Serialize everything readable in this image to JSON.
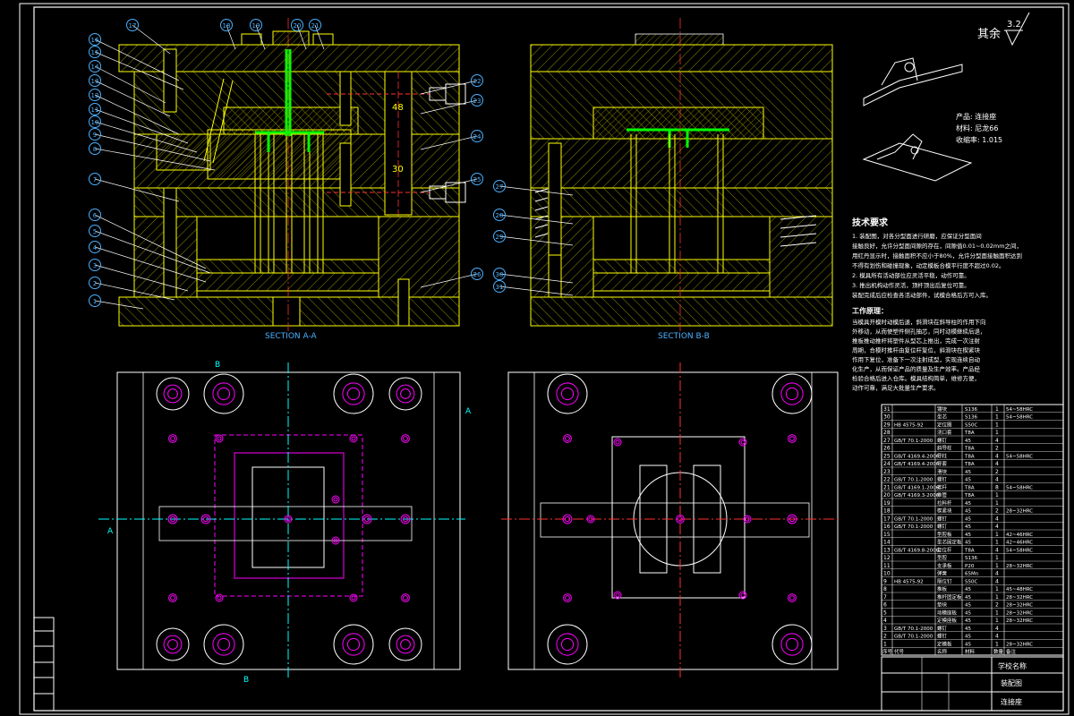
{
  "surface_finish": {
    "label": "其余",
    "value": "3.2"
  },
  "sections": {
    "a": "SECTION A-A",
    "b": "SECTION B-B"
  },
  "cut_letters": {
    "a": "A",
    "b": "B"
  },
  "dimensions": {
    "d1": "48",
    "d2": "30"
  },
  "product": {
    "name": "产品: 连接座",
    "material": "材料: 尼龙66",
    "shrinkage": "收缩率: 1.015"
  },
  "tech_req": {
    "title": "技术要求",
    "lines": [
      "1. 装配图，对各分型面进行研磨，应保证分型面间",
      "接触良好，允许分型面间隙的存在，间隙值0.01~0.02mm之间，",
      "用红丹显示时，接触面积不应小于80%，允许分型面接触面积达到",
      "不得有划伤和碰撞现象，动定模板合模平行度不超过0.02。",
      "2. 模具所有活动部位应灵活平稳，动作可靠。",
      "3. 推出机构动作灵活，顶杆顶出后复位可靠。",
      "装配完成后应检查各活动部件，试模合格后方可入库。"
    ]
  },
  "work_proc": {
    "title": "工作原理：",
    "lines": [
      "当模具开模时动模后退，斜滑块在斜导柱的作用下向",
      "外移动，从而使塑件侧孔抽芯，同时动模继续后退，",
      "推板推动推杆将塑件从型芯上推出，完成一次注射",
      "周期，合模时推杆由复位杆复位，斜滑块在楔紧块",
      "作用下复位，准备下一次注射成型，实现连续自动",
      "化生产，从而保证产品的质量及生产效率。产品经",
      "检验合格后进入仓库。模具结构简单，维修方便，",
      "动作可靠，满足大批量生产要求。"
    ]
  },
  "title_block": {
    "school": "学校名称",
    "drawing": "装配图",
    "name": "连接座"
  },
  "callouts": {
    "left": [
      "17",
      "16",
      "15",
      "14",
      "13",
      "12",
      "11",
      "10",
      "9",
      "8",
      "7",
      "6",
      "5",
      "4",
      "3",
      "2",
      "1"
    ],
    "top": [
      "18",
      "19",
      "20",
      "21"
    ],
    "right": [
      "22",
      "23",
      "24",
      "25",
      "26"
    ],
    "b_left": [
      "27",
      "28",
      "29",
      "30",
      "31"
    ]
  },
  "bom": {
    "rows": [
      {
        "no": "31",
        "std": "",
        "name": "镶块",
        "mat": "S136",
        "qty": "1",
        "note": "54~58HRC"
      },
      {
        "no": "30",
        "std": "",
        "name": "型芯",
        "mat": "S136",
        "qty": "1",
        "note": "54~58HRC"
      },
      {
        "no": "29",
        "std": "HB 4575-92",
        "name": "定位圈",
        "mat": "S50C",
        "qty": "1",
        "note": ""
      },
      {
        "no": "28",
        "std": "",
        "name": "浇口套",
        "mat": "T8A",
        "qty": "1",
        "note": ""
      },
      {
        "no": "27",
        "std": "GB/T 70.1-2000",
        "name": "螺钉",
        "mat": "45",
        "qty": "4",
        "note": ""
      },
      {
        "no": "26",
        "std": "",
        "name": "斜导柱",
        "mat": "T8A",
        "qty": "2",
        "note": ""
      },
      {
        "no": "25",
        "std": "GB/T 4169.4-2006",
        "name": "导柱",
        "mat": "T8A",
        "qty": "4",
        "note": "54~58HRC"
      },
      {
        "no": "24",
        "std": "GB/T 4169.4-2006",
        "name": "导套",
        "mat": "T8A",
        "qty": "4",
        "note": ""
      },
      {
        "no": "23",
        "std": "",
        "name": "滑块",
        "mat": "45",
        "qty": "2",
        "note": ""
      },
      {
        "no": "22",
        "std": "GB/T 70.1-2000",
        "name": "螺钉",
        "mat": "45",
        "qty": "4",
        "note": ""
      },
      {
        "no": "21",
        "std": "GB/T 4169.1-2006",
        "name": "推杆",
        "mat": "T8A",
        "qty": "8",
        "note": "54~58HRC"
      },
      {
        "no": "20",
        "std": "GB/T 4169.3-2006",
        "name": "推管",
        "mat": "T8A",
        "qty": "1",
        "note": ""
      },
      {
        "no": "19",
        "std": "",
        "name": "拉料杆",
        "mat": "45",
        "qty": "1",
        "note": ""
      },
      {
        "no": "18",
        "std": "",
        "name": "楔紧块",
        "mat": "45",
        "qty": "2",
        "note": "28~32HRC"
      },
      {
        "no": "17",
        "std": "GB/T 70.1-2000",
        "name": "螺钉",
        "mat": "45",
        "qty": "4",
        "note": ""
      },
      {
        "no": "16",
        "std": "GB/T 70.1-2000",
        "name": "螺钉",
        "mat": "45",
        "qty": "4",
        "note": ""
      },
      {
        "no": "15",
        "std": "",
        "name": "型腔板",
        "mat": "45",
        "qty": "1",
        "note": "42~46HRC"
      },
      {
        "no": "14",
        "std": "",
        "name": "型芯固定板",
        "mat": "45",
        "qty": "1",
        "note": "42~46HRC"
      },
      {
        "no": "13",
        "std": "GB/T 4169.8-2006",
        "name": "复位杆",
        "mat": "T8A",
        "qty": "4",
        "note": "54~58HRC"
      },
      {
        "no": "12",
        "std": "",
        "name": "型腔",
        "mat": "S136",
        "qty": "1",
        "note": ""
      },
      {
        "no": "11",
        "std": "",
        "name": "支承板",
        "mat": "P20",
        "qty": "1",
        "note": "28~32HRC"
      },
      {
        "no": "10",
        "std": "",
        "name": "弹簧",
        "mat": "65Mn",
        "qty": "4",
        "note": ""
      },
      {
        "no": "9",
        "std": "HB 4575-92",
        "name": "限位钉",
        "mat": "S50C",
        "qty": "4",
        "note": ""
      },
      {
        "no": "8",
        "std": "",
        "name": "推板",
        "mat": "45",
        "qty": "1",
        "note": "45~48HRC"
      },
      {
        "no": "7",
        "std": "",
        "name": "推杆固定板",
        "mat": "45",
        "qty": "1",
        "note": "28~32HRC"
      },
      {
        "no": "6",
        "std": "",
        "name": "垫块",
        "mat": "45",
        "qty": "2",
        "note": "28~32HRC"
      },
      {
        "no": "5",
        "std": "",
        "name": "动模座板",
        "mat": "45",
        "qty": "1",
        "note": "28~32HRC"
      },
      {
        "no": "4",
        "std": "",
        "name": "定模座板",
        "mat": "45",
        "qty": "1",
        "note": "28~32HRC"
      },
      {
        "no": "3",
        "std": "GB/T 70.1-2000",
        "name": "螺钉",
        "mat": "45",
        "qty": "4",
        "note": ""
      },
      {
        "no": "2",
        "std": "GB/T 70.1-2000",
        "name": "螺钉",
        "mat": "45",
        "qty": "4",
        "note": ""
      },
      {
        "no": "1",
        "std": "",
        "name": "定模板",
        "mat": "45",
        "qty": "1",
        "note": "28~32HRC"
      }
    ],
    "header": {
      "no": "序号",
      "std": "代号",
      "name": "名称",
      "mat": "材料",
      "qty": "数量",
      "note": "备注"
    }
  },
  "colors": {
    "bg": "#000000",
    "frame": "#ffffff",
    "steel": "#ffff00",
    "hole": "#ff00ff",
    "center": "#ff3030",
    "gate": "#00ff00",
    "aux": "#00ffff",
    "text": "#ffffff"
  }
}
